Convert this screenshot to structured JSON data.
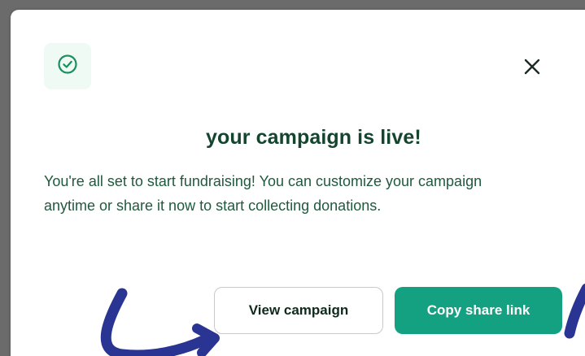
{
  "dialog": {
    "title": "your campaign is live!",
    "message": "You're all set to start fundraising! You can customize your campaign anytime or share it now to start collecting donations.",
    "buttons": {
      "view_campaign": "View campaign",
      "copy_share_link": "Copy share link"
    },
    "icons": {
      "status": "check-circle-icon",
      "close": "close-icon"
    }
  },
  "colors": {
    "accent": "#13a181",
    "title_text": "#14452f",
    "body_text": "#1f5a3d",
    "icon_badge_bg": "#effaf5",
    "annotation_arrow": "#2a3593"
  }
}
